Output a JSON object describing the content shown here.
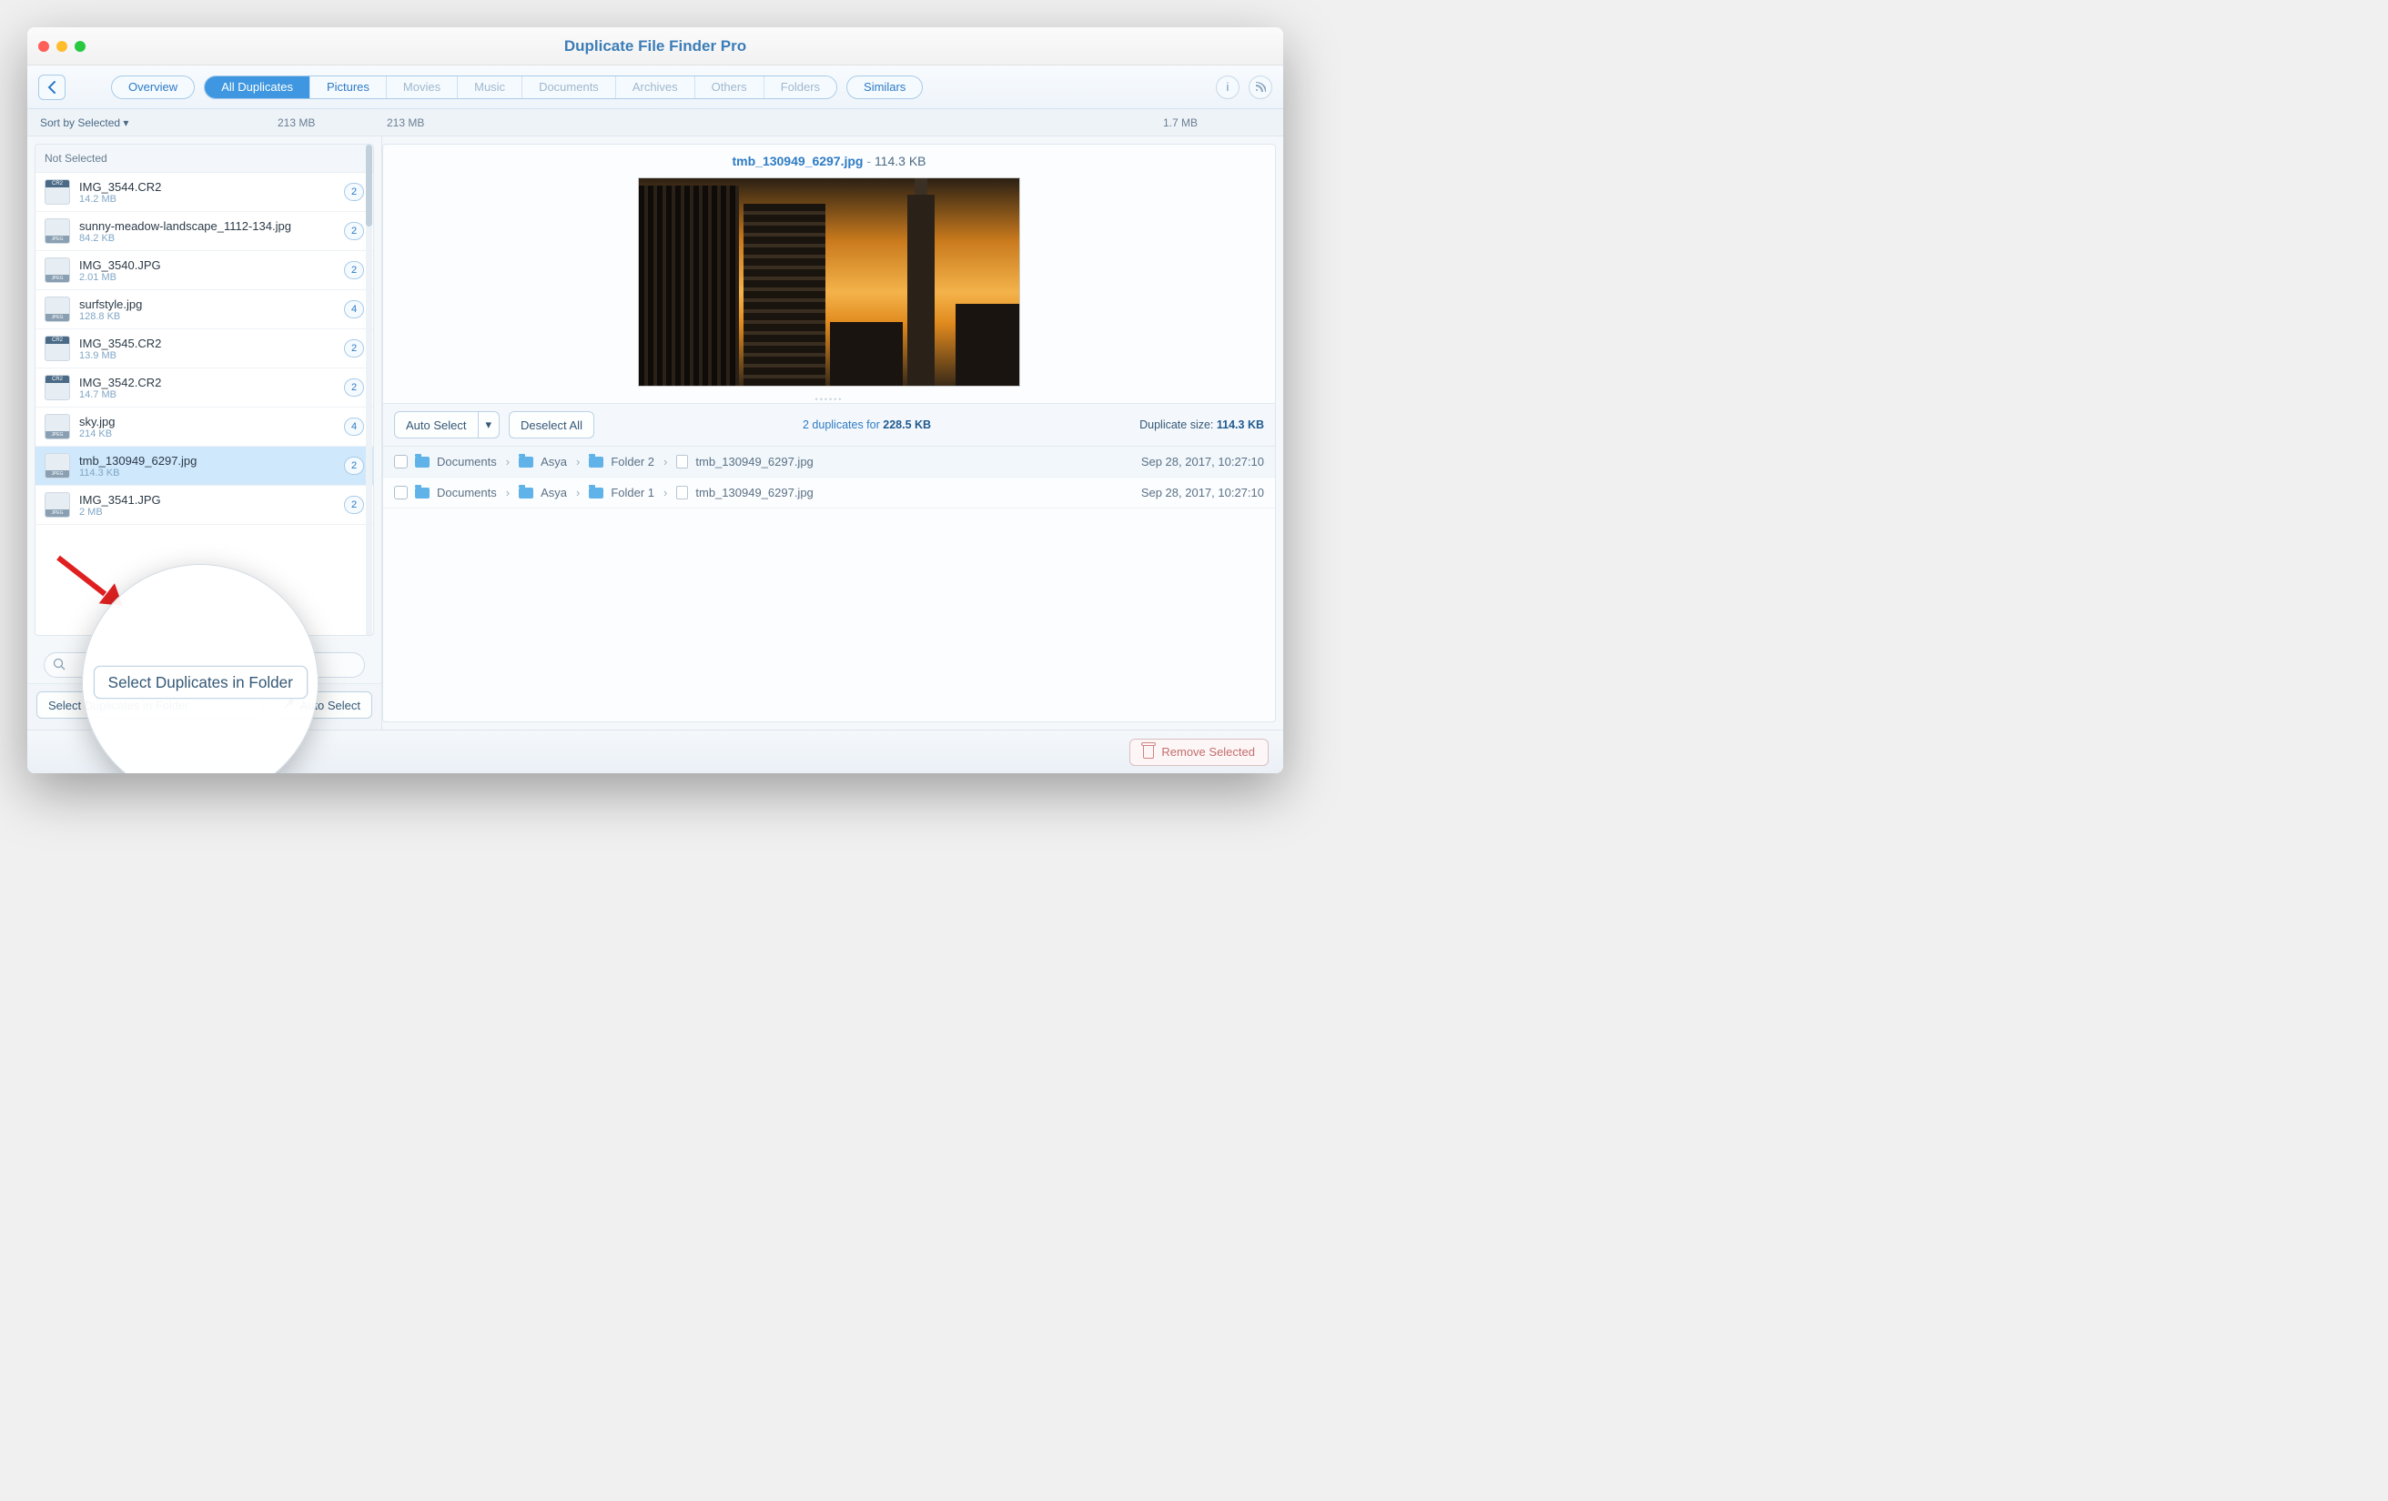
{
  "window": {
    "title": "Duplicate File Finder Pro"
  },
  "toolbar": {
    "overview": "Overview",
    "tabs": [
      "All Duplicates",
      "Pictures",
      "Movies",
      "Music",
      "Documents",
      "Archives",
      "Others",
      "Folders"
    ],
    "active_tab": 0,
    "similars": "Similars"
  },
  "subbar": {
    "sort_label": "Sort by Selected",
    "size_all": "213 MB",
    "size_pictures": "213 MB",
    "size_similars": "1.7 MB"
  },
  "sidebar": {
    "group_header": "Not Selected",
    "items": [
      {
        "name": "IMG_3544.CR2",
        "size": "14.2 MB",
        "count": "2",
        "kind": "cr2"
      },
      {
        "name": "sunny-meadow-landscape_1112-134.jpg",
        "size": "84.2 KB",
        "count": "2",
        "kind": "jpeg"
      },
      {
        "name": "IMG_3540.JPG",
        "size": "2.01 MB",
        "count": "2",
        "kind": "jpeg"
      },
      {
        "name": "surfstyle.jpg",
        "size": "128.8 KB",
        "count": "4",
        "kind": "jpeg"
      },
      {
        "name": "IMG_3545.CR2",
        "size": "13.9 MB",
        "count": "2",
        "kind": "cr2"
      },
      {
        "name": "IMG_3542.CR2",
        "size": "14.7 MB",
        "count": "2",
        "kind": "cr2"
      },
      {
        "name": "sky.jpg",
        "size": "214 KB",
        "count": "4",
        "kind": "jpeg"
      },
      {
        "name": "tmb_130949_6297.jpg",
        "size": "114.3 KB",
        "count": "2",
        "kind": "jpeg",
        "selected": true
      },
      {
        "name": "IMG_3541.JPG",
        "size": "2 MB",
        "count": "2",
        "kind": "jpeg"
      }
    ],
    "select_in_folder": "Select Duplicates in Folder",
    "auto_select": "Auto Select"
  },
  "preview": {
    "filename": "tmb_130949_6297.jpg",
    "size": "114.3 KB"
  },
  "dupbar": {
    "auto_select": "Auto Select",
    "deselect_all": "Deselect All",
    "count_text_a": "2 duplicates for ",
    "count_text_b": "228.5 KB",
    "size_label": "Duplicate size: ",
    "size_value": "114.3 KB"
  },
  "duplicates": [
    {
      "path": [
        "Documents",
        "Asya",
        "Folder 2"
      ],
      "file": "tmb_130949_6297.jpg",
      "date": "Sep 28, 2017, 10:27:10"
    },
    {
      "path": [
        "Documents",
        "Asya",
        "Folder 1"
      ],
      "file": "tmb_130949_6297.jpg",
      "date": "Sep 28, 2017, 10:27:10"
    }
  ],
  "footer": {
    "remove": "Remove Selected"
  }
}
